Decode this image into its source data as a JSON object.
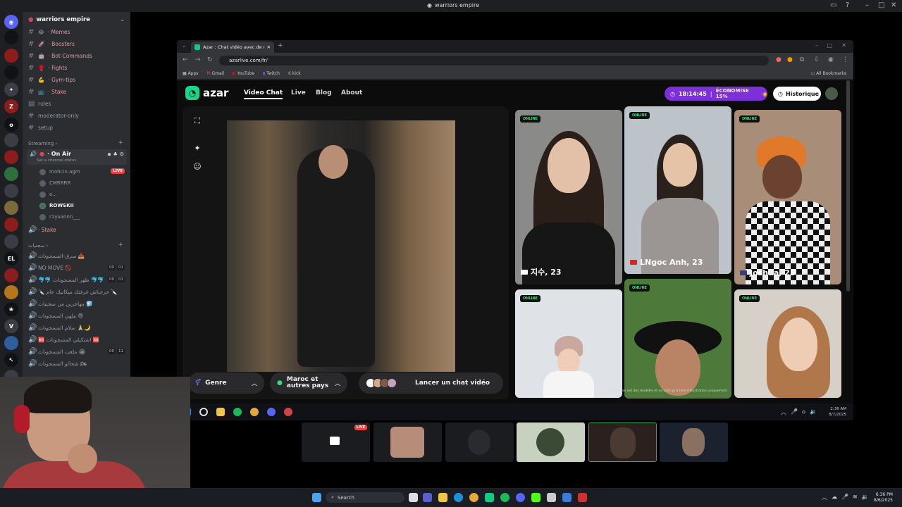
{
  "window": {
    "title": "warriors empire"
  },
  "server": {
    "name": "warriors empire",
    "channels": [
      {
        "label": "· Memes",
        "emoji": "😂"
      },
      {
        "label": "· Boosters",
        "emoji": "🚀"
      },
      {
        "label": "· Bot-Commands",
        "emoji": "🤖"
      },
      {
        "label": "· Fights",
        "emoji": "🥊"
      },
      {
        "label": "· Gym-tips",
        "emoji": "💪"
      },
      {
        "label": "· Stake",
        "emoji": "📺"
      }
    ],
    "plain_channels": [
      "rules",
      "moderator-only",
      "setup"
    ],
    "streaming_category": "Streaming",
    "active_voice": {
      "name": "· On Air",
      "status": "Set a channel status"
    },
    "voice_users": [
      {
        "name": "mohcin.agm",
        "live": "LIVE"
      },
      {
        "name": "CMRRRR"
      },
      {
        "name": "o..."
      },
      {
        "name": "ROWSKII"
      },
      {
        "name": "r1yaannn___"
      }
    ],
    "stake_voice": "· Stake",
    "arabic_category": "سجنيات",
    "arabic_channels": [
      {
        "label": "سرق-المسجونات 📤"
      },
      {
        "label": "NO MOVE 🚫",
        "counts": [
          "00",
          "01"
        ]
      },
      {
        "label": "🐬🐬 ظهر المسجونات 🐬🐬",
        "counts": [
          "00",
          "01"
        ]
      },
      {
        "label": "🔪 خرجناش غرفتك ميكانيك عام 🔪"
      },
      {
        "label": "مهاجرين من سجنيات 🧊"
      },
      {
        "label": "ملهي المسجونات 😎"
      },
      {
        "label": "سلام المسجونات 🙏🌙"
      },
      {
        "label": "🆘 اشتكيلي المسجونات 🆘"
      },
      {
        "label": "ملعب المسجونات 🏟",
        "counts": [
          "00",
          "11"
        ]
      },
      {
        "label": "شحالو المسجونات 🏍"
      }
    ]
  },
  "browser": {
    "tab_title": "Azar : Chat vidéo avec de n...",
    "url": "azarlive.com/fr/",
    "bookmarks": [
      "Apps",
      "Gmail",
      "YouTube",
      "Twitch",
      "kick"
    ],
    "all_bookmarks": "All Bookmarks"
  },
  "azar": {
    "brand": "azar",
    "nav": [
      "Video Chat",
      "Live",
      "Blog",
      "About"
    ],
    "timer": "18:14:45",
    "promo": "ÉCONOMISE 15%",
    "history": "Historique",
    "filters": {
      "gender": "Genre",
      "region_line1": "Maroc et",
      "region_line2": "autres pays",
      "start": "Lancer un chat vidéo"
    },
    "online_badge": "ONLINE",
    "profiles": [
      {
        "name": "지수, 23"
      },
      {
        "name": "LNgoc Anh, 23"
      },
      {
        "name": "Joshua, 25"
      }
    ],
    "disclaimer": "Les images ont des modèles et ne sont qu'à titre d'illustration uniquement."
  },
  "inner_taskbar": {
    "time": "2:36 AM",
    "date": "8/7/2025"
  },
  "thumbnails": {
    "live": "LIVE"
  },
  "taskbar": {
    "search": "Search",
    "time": "6:36 PM",
    "date": "8/6/2025"
  },
  "colors": {
    "accent": "#17d68a",
    "promo": "#7d2fd8",
    "live": "#ed4245"
  }
}
